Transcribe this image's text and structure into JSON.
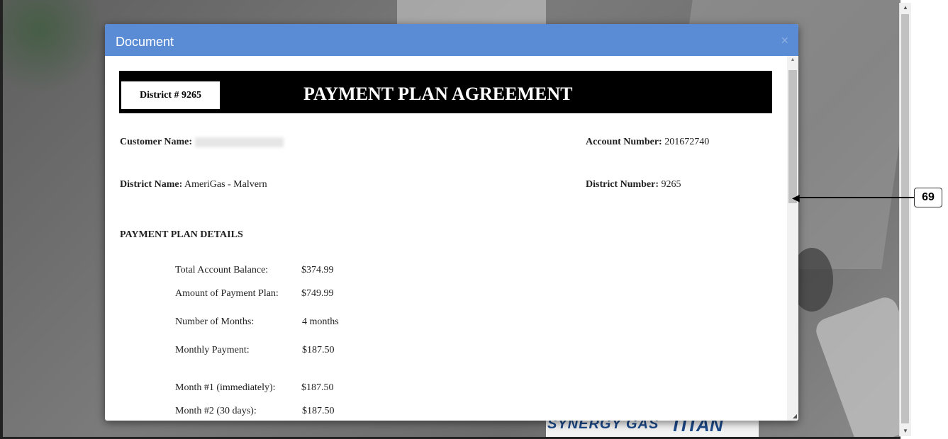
{
  "modal": {
    "title": "Document",
    "close_glyph": "×"
  },
  "document": {
    "district_box": "District # 9265",
    "heading": "PAYMENT PLAN AGREEMENT",
    "customer_name_label": "Customer Name:",
    "customer_name_value": "",
    "account_number_label": "Account Number:",
    "account_number_value": "201672740",
    "district_name_label": "District Name:",
    "district_name_value": "AmeriGas - Malvern",
    "district_number_label": "District Number:",
    "district_number_value": "9265",
    "section_title": "PAYMENT PLAN DETAILS",
    "details": [
      {
        "label": "Total Account Balance:",
        "value": "$374.99"
      },
      {
        "label": "Amount of Payment Plan:",
        "value": "$749.99"
      },
      {
        "label": "Number of Months:",
        "value": "4 months"
      },
      {
        "label": "Monthly Payment:",
        "value": "$187.50"
      },
      {
        "label": "Month #1 (immediately):",
        "value": "$187.50"
      },
      {
        "label": "Month #2 (30 days):",
        "value": "$187.50"
      }
    ]
  },
  "background": {
    "logo_left": "SYNERGY GAS",
    "logo_right": "TITAN"
  },
  "annotation": {
    "badge": "69"
  },
  "colors": {
    "header": "#5a8cd6",
    "banner": "#000000"
  }
}
